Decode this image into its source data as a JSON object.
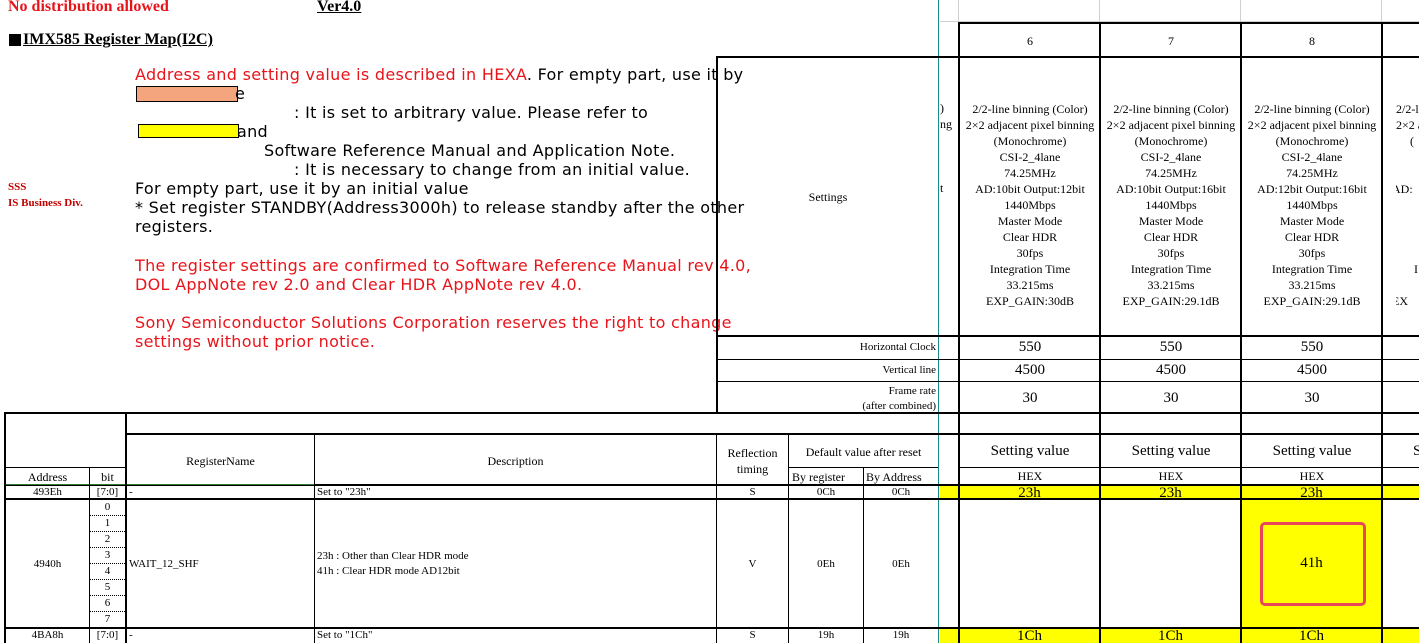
{
  "header": {
    "no_distribution": "No distribution allowed",
    "version": "Ver4.0",
    "title": "IMX585 Register Map(I2C)",
    "org_line1": "SSS",
    "org_line2": "IS Business Div."
  },
  "notes": {
    "line1_red": "Address and setting value is described in HEXA",
    "line1_black": ". For empty part, use it by",
    "line2": "e",
    "line3": ": It is set to arbitrary value. Please refer to",
    "line4": "and",
    "line5": "Software Reference Manual and Application Note.",
    "line6": ": It is necessary to change from an initial value.",
    "line7": "For empty part, use it by an initial value",
    "line8": "* Set register STANDBY(Address3000h) to release standby after the other",
    "line9": "registers.",
    "line10": "The register settings are confirmed to Software Reference Manual rev 4.0,",
    "line11": "DOL AppNote rev 2.0 and Clear HDR AppNote rev 4.0.",
    "line12": "Sony Semiconductor Solutions Corporation reserves the right to change",
    "line13": "settings without  prior notice.",
    "colors": {
      "orange_swatch": "#f4a57e",
      "yellow_swatch": "#ffff00"
    }
  },
  "settings": {
    "label": "Settings",
    "horizontal_clock": "Horizontal Clock",
    "vertical_line": "Vertical line",
    "frame_rate_1": "Frame rate",
    "frame_rate_2": "(after combined)",
    "partial_col_texts": [
      ")",
      "ng",
      "t"
    ],
    "columns": [
      {
        "number": "6",
        "mode_lines": [
          "2/2-line binning (Color)",
          "2×2 adjacent pixel binning",
          "(Monochrome)",
          "CSI-2_4lane",
          "74.25MHz",
          "AD:10bit Output:12bit",
          "1440Mbps",
          "Master Mode",
          "Clear HDR",
          "30fps",
          "Integration Time",
          "33.215ms",
          "EXP_GAIN:30dB"
        ],
        "h_clock": "550",
        "v_line": "4500",
        "frame_rate": "30",
        "setting_value": "Setting value",
        "hex": "HEX",
        "val_493E": "23h",
        "val_4940": "",
        "val_4BA8": "1Ch"
      },
      {
        "number": "7",
        "mode_lines": [
          "2/2-line binning (Color)",
          "2×2 adjacent pixel binning",
          "(Monochrome)",
          "CSI-2_4lane",
          "74.25MHz",
          "AD:10bit Output:16bit",
          "1440Mbps",
          "Master Mode",
          "Clear HDR",
          "30fps",
          "Integration Time",
          "33.215ms",
          "EXP_GAIN:29.1dB"
        ],
        "h_clock": "550",
        "v_line": "4500",
        "frame_rate": "30",
        "setting_value": "Setting value",
        "hex": "HEX",
        "val_493E": "23h",
        "val_4940": "",
        "val_4BA8": "1Ch"
      },
      {
        "number": "8",
        "mode_lines": [
          "2/2-line binning (Color)",
          "2×2 adjacent pixel binning",
          "(Monochrome)",
          "CSI-2_4lane",
          "74.25MHz",
          "AD:12bit Output:16bit",
          "1440Mbps",
          "Master Mode",
          "Clear HDR",
          "30fps",
          "Integration Time",
          "33.215ms",
          "EXP_GAIN:29.1dB"
        ],
        "h_clock": "550",
        "v_line": "4500",
        "frame_rate": "30",
        "setting_value": "Setting value",
        "hex": "HEX",
        "val_493E": "23h",
        "val_4940": "41h",
        "val_4BA8": "1Ch"
      }
    ],
    "partial_col9": {
      "mode_lines": [
        "2/2-l",
        "2×2 a",
        "(",
        "",
        "",
        "AD:",
        "",
        "",
        "",
        "",
        "I",
        "",
        "EX"
      ],
      "setting_value": "S"
    }
  },
  "table": {
    "headers": {
      "address": "Address",
      "bit": "bit",
      "register_name": "RegisterName",
      "description": "Description",
      "reflection_1": "Reflection",
      "reflection_2": "timing",
      "default_value": "Default value after reset",
      "by_register": "By register",
      "by_address": "By Address"
    },
    "rows": [
      {
        "address": "493Eh",
        "bit": "[7:0]",
        "register_name": "-",
        "description": "Set to \"23h\"",
        "reflection": "S",
        "by_register": "0Ch",
        "by_address": "0Ch"
      },
      {
        "address": "4940h",
        "bits": [
          "0",
          "1",
          "2",
          "3",
          "4",
          "5",
          "6",
          "7"
        ],
        "register_name": "WAIT_12_SHF",
        "description_lines": [
          "23h : Other than Clear HDR mode",
          "41h : Clear HDR mode AD12bit"
        ],
        "reflection": "V",
        "by_register": "0Eh",
        "by_address": "0Eh"
      },
      {
        "address": "4BA8h",
        "bit": "[7:0]",
        "register_name": "-",
        "description": "Set to \"1Ch\"",
        "reflection": "S",
        "by_register": "19h",
        "by_address": "19h"
      }
    ]
  },
  "colors": {
    "highlight_yellow": "#ffff00",
    "annotation_red": "#e8475a",
    "title_red": "#e8141a"
  }
}
